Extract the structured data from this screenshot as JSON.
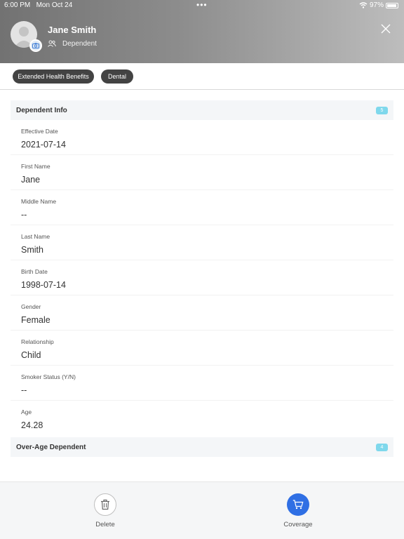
{
  "status_bar": {
    "time": "6:00 PM",
    "date": "Mon Oct 24",
    "battery": "97%",
    "dots": "•••"
  },
  "header": {
    "name": "Jane Smith",
    "role": "Dependent"
  },
  "tags": [
    {
      "label": "Extended Health Benefits"
    },
    {
      "label": "Dental"
    }
  ],
  "sections": {
    "dependent_info": {
      "title": "Dependent Info",
      "badge": "5"
    },
    "over_age": {
      "title": "Over-Age Dependent",
      "badge": "4"
    }
  },
  "fields": [
    {
      "label": "Effective Date",
      "value": "2021-07-14"
    },
    {
      "label": "First Name",
      "value": "Jane"
    },
    {
      "label": "Middle Name",
      "value": "--"
    },
    {
      "label": "Last Name",
      "value": "Smith"
    },
    {
      "label": "Birth Date",
      "value": "1998-07-14"
    },
    {
      "label": "Gender",
      "value": "Female"
    },
    {
      "label": "Relationship",
      "value": "Child"
    },
    {
      "label": "Smoker Status (Y/N)",
      "value": "--"
    },
    {
      "label": "Age",
      "value": "24.28"
    }
  ],
  "actions": {
    "delete_label": "Delete",
    "coverage_label": "Coverage"
  },
  "colors": {
    "accent": "#2f6fe4",
    "badge": "#7fd8ec",
    "tag": "#434343"
  }
}
